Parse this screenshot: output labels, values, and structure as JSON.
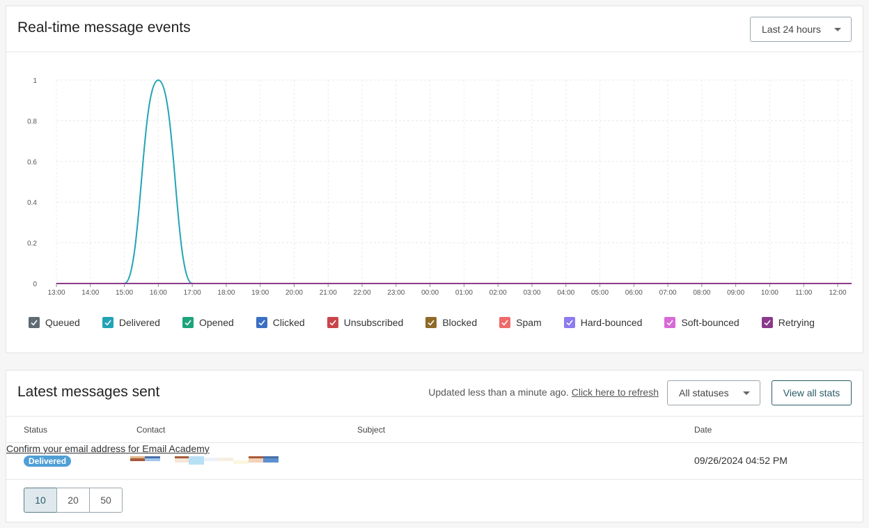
{
  "events": {
    "title": "Real-time message events",
    "range_dropdown": "Last 24 hours"
  },
  "chart_data": {
    "type": "line",
    "title": "",
    "xlabel": "",
    "ylabel": "",
    "x": [
      "13:00",
      "14:00",
      "15:00",
      "16:00",
      "17:00",
      "18:00",
      "19:00",
      "20:00",
      "21:00",
      "22:00",
      "23:00",
      "00:00",
      "01:00",
      "02:00",
      "03:00",
      "04:00",
      "05:00",
      "06:00",
      "07:00",
      "08:00",
      "09:00",
      "10:00",
      "11:00",
      "12:00"
    ],
    "ylim": [
      0,
      1
    ],
    "yticks": [
      "0",
      "0.2",
      "0.4",
      "0.6",
      "0.8",
      "1"
    ],
    "yticks_values": [
      0,
      0.2,
      0.4,
      0.6,
      0.8,
      1
    ],
    "grid": true,
    "legend_position": "bottom",
    "series": [
      {
        "name": "Queued",
        "color": "#5f6b73",
        "values": [
          0,
          0,
          0,
          0,
          0,
          0,
          0,
          0,
          0,
          0,
          0,
          0,
          0,
          0,
          0,
          0,
          0,
          0,
          0,
          0,
          0,
          0,
          0,
          0
        ]
      },
      {
        "name": "Delivered",
        "color": "#22a3b7",
        "values": [
          0,
          0,
          0,
          1,
          0,
          0,
          0,
          0,
          0,
          0,
          0,
          0,
          0,
          0,
          0,
          0,
          0,
          0,
          0,
          0,
          0,
          0,
          0,
          0
        ]
      },
      {
        "name": "Opened",
        "color": "#1fa37a",
        "values": [
          0,
          0,
          0,
          0,
          0,
          0,
          0,
          0,
          0,
          0,
          0,
          0,
          0,
          0,
          0,
          0,
          0,
          0,
          0,
          0,
          0,
          0,
          0,
          0
        ]
      },
      {
        "name": "Clicked",
        "color": "#3b6fc2",
        "values": [
          0,
          0,
          0,
          0,
          0,
          0,
          0,
          0,
          0,
          0,
          0,
          0,
          0,
          0,
          0,
          0,
          0,
          0,
          0,
          0,
          0,
          0,
          0,
          0
        ]
      },
      {
        "name": "Unsubscribed",
        "color": "#c9454a",
        "values": [
          0,
          0,
          0,
          0,
          0,
          0,
          0,
          0,
          0,
          0,
          0,
          0,
          0,
          0,
          0,
          0,
          0,
          0,
          0,
          0,
          0,
          0,
          0,
          0
        ]
      },
      {
        "name": "Blocked",
        "color": "#8f6a2a",
        "values": [
          0,
          0,
          0,
          0,
          0,
          0,
          0,
          0,
          0,
          0,
          0,
          0,
          0,
          0,
          0,
          0,
          0,
          0,
          0,
          0,
          0,
          0,
          0,
          0
        ]
      },
      {
        "name": "Spam",
        "color": "#ee6b6b",
        "values": [
          0,
          0,
          0,
          0,
          0,
          0,
          0,
          0,
          0,
          0,
          0,
          0,
          0,
          0,
          0,
          0,
          0,
          0,
          0,
          0,
          0,
          0,
          0,
          0
        ]
      },
      {
        "name": "Hard-bounced",
        "color": "#8c7cf0",
        "values": [
          0,
          0,
          0,
          0,
          0,
          0,
          0,
          0,
          0,
          0,
          0,
          0,
          0,
          0,
          0,
          0,
          0,
          0,
          0,
          0,
          0,
          0,
          0,
          0
        ]
      },
      {
        "name": "Soft-bounced",
        "color": "#d86ad8",
        "values": [
          0,
          0,
          0,
          0,
          0,
          0,
          0,
          0,
          0,
          0,
          0,
          0,
          0,
          0,
          0,
          0,
          0,
          0,
          0,
          0,
          0,
          0,
          0,
          0
        ]
      },
      {
        "name": "Retrying",
        "color": "#8b3a8b",
        "values": [
          0,
          0,
          0,
          0,
          0,
          0,
          0,
          0,
          0,
          0,
          0,
          0,
          0,
          0,
          0,
          0,
          0,
          0,
          0,
          0,
          0,
          0,
          0,
          0
        ]
      }
    ]
  },
  "latest": {
    "title": "Latest messages sent",
    "updated_text": "Updated less than a minute ago.",
    "refresh_link": "Click here to refresh",
    "status_dropdown": "All statuses",
    "view_all_button": "View all stats",
    "columns": {
      "status": "Status",
      "contact": "Contact",
      "subject": "Subject",
      "date": "Date"
    },
    "rows": [
      {
        "status": "Delivered",
        "subject": "Confirm your email address for Email Academy",
        "date": "09/26/2024 04:52 PM"
      }
    ],
    "page_sizes": [
      "10",
      "20",
      "50"
    ]
  }
}
